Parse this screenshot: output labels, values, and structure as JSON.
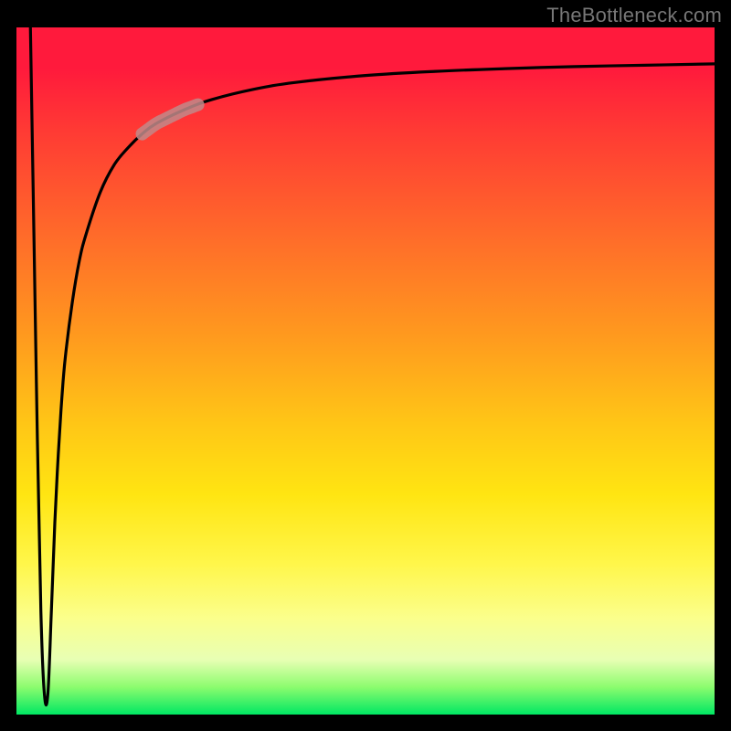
{
  "attribution": "TheBottleneck.com",
  "chart_data": {
    "type": "line",
    "title": "",
    "xlabel": "",
    "ylabel": "",
    "xlim": [
      0,
      100
    ],
    "ylim": [
      0,
      100
    ],
    "grid": false,
    "legend": false,
    "series": [
      {
        "name": "bottleneck-curve",
        "x": [
          2.0,
          2.5,
          3.0,
          3.5,
          4.0,
          4.5,
          5.0,
          5.5,
          6.0,
          6.5,
          7.0,
          8.0,
          9.0,
          10.0,
          12.0,
          14.0,
          16.0,
          18.0,
          20.0,
          24.0,
          28.0,
          34.0,
          40.0,
          50.0,
          60.0,
          70.0,
          80.0,
          90.0,
          100.0
        ],
        "y": [
          100.0,
          70.0,
          40.0,
          15.0,
          3.0,
          3.0,
          15.0,
          28.0,
          38.0,
          46.0,
          52.0,
          60.0,
          66.0,
          70.0,
          76.0,
          80.0,
          82.5,
          84.5,
          86.0,
          88.0,
          89.5,
          91.0,
          92.0,
          93.0,
          93.6,
          94.0,
          94.3,
          94.5,
          94.7
        ]
      }
    ],
    "highlight_segment": {
      "series": "bottleneck-curve",
      "x_start": 18.0,
      "x_end": 26.0,
      "note": "thick faded-rose overlay on the curve"
    },
    "background_gradient": {
      "direction": "vertical",
      "stops": [
        {
          "pos": 0.0,
          "color": "#ff1a3c"
        },
        {
          "pos": 0.45,
          "color": "#ff9a1e"
        },
        {
          "pos": 0.7,
          "color": "#ffe512"
        },
        {
          "pos": 0.92,
          "color": "#e8ffb4"
        },
        {
          "pos": 1.0,
          "color": "#00e763"
        }
      ]
    }
  }
}
